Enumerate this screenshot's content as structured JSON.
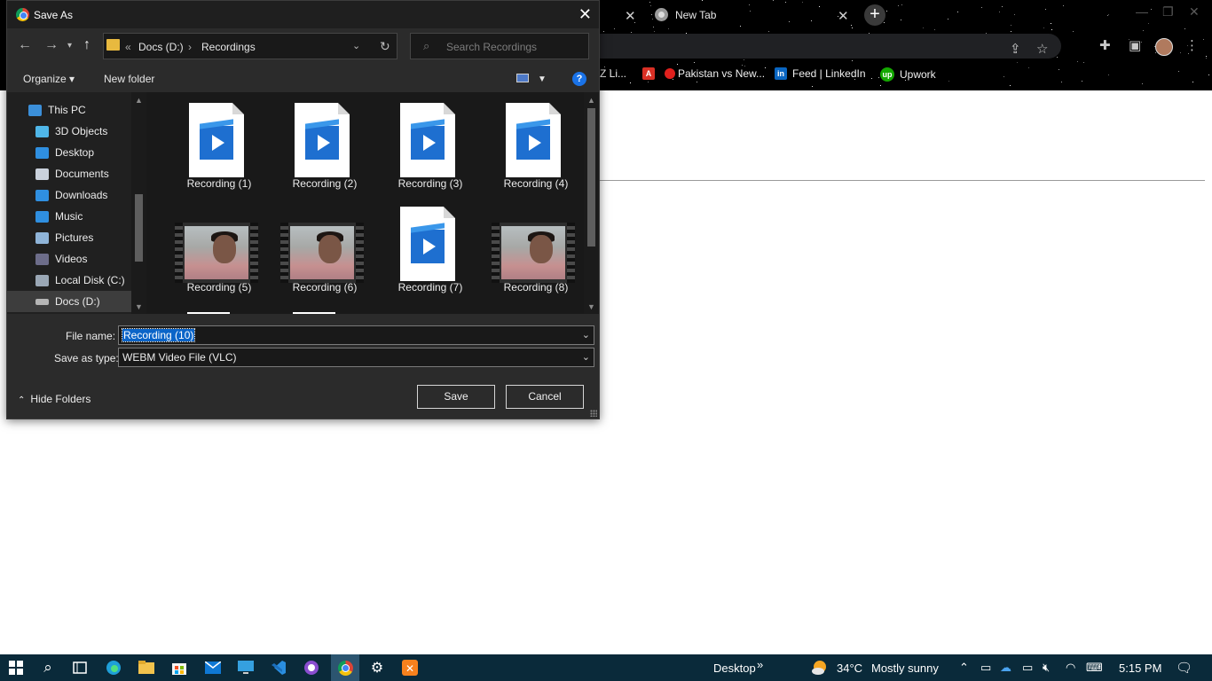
{
  "browser": {
    "tabs": [
      {
        "label": ""
      },
      {
        "label": "New Tab"
      }
    ],
    "new_tab_symbol": "+",
    "bookmarks": [
      {
        "label": "Z Li...",
        "icon": "bookmark-icon",
        "color": "#3a3a3a"
      },
      {
        "label": "",
        "icon": "pdf-icon",
        "color": "#d93025"
      },
      {
        "label": "Pakistan vs New...",
        "icon": "red-dot-icon",
        "color": "#e0201d"
      },
      {
        "label": "Feed | LinkedIn",
        "icon": "linkedin-icon",
        "color": "#0a66c2"
      },
      {
        "label": "Upwork",
        "icon": "upwork-icon",
        "color": "#14a800"
      }
    ]
  },
  "dialog": {
    "title": "Save As",
    "breadcrumb": {
      "prefix": "«",
      "drive": "Docs (D:)",
      "separator": "›",
      "folder": "Recordings"
    },
    "search_placeholder": "Search Recordings",
    "toolbar": {
      "organize": "Organize ▾",
      "new_folder": "New folder",
      "help": "?"
    },
    "nav_items": [
      {
        "label": "This PC",
        "icon": "pc-icon",
        "color": "#3b8fd9"
      },
      {
        "label": "3D Objects",
        "icon": "cube-icon",
        "color": "#4fb6e8"
      },
      {
        "label": "Desktop",
        "icon": "desktop-icon",
        "color": "#2f8fe0"
      },
      {
        "label": "Documents",
        "icon": "documents-icon",
        "color": "#c9d1dc"
      },
      {
        "label": "Downloads",
        "icon": "download-icon",
        "color": "#2f8fe0"
      },
      {
        "label": "Music",
        "icon": "music-icon",
        "color": "#2f8fe0"
      },
      {
        "label": "Pictures",
        "icon": "pictures-icon",
        "color": "#8fb4d8"
      },
      {
        "label": "Videos",
        "icon": "videos-icon",
        "color": "#6d6d8a"
      },
      {
        "label": "Local Disk (C:)",
        "icon": "disk-icon",
        "color": "#9aa7b5"
      },
      {
        "label": "Docs (D:)",
        "icon": "drive-icon",
        "color": "#b5b5b5"
      }
    ],
    "files": [
      {
        "name": "Recording (1)",
        "kind": "doc"
      },
      {
        "name": "Recording (2)",
        "kind": "doc"
      },
      {
        "name": "Recording (3)",
        "kind": "doc"
      },
      {
        "name": "Recording (4)",
        "kind": "doc"
      },
      {
        "name": "Recording (5)",
        "kind": "thumb"
      },
      {
        "name": "Recording (6)",
        "kind": "thumb"
      },
      {
        "name": "Recording (7)",
        "kind": "doc"
      },
      {
        "name": "Recording (8)",
        "kind": "thumb"
      }
    ],
    "file_name_label": "File name:",
    "file_name_value": "Recording (10)",
    "save_type_label": "Save as type:",
    "save_type_value": "WEBM Video File (VLC)",
    "hide_folders": "Hide Folders",
    "save_button": "Save",
    "cancel_button": "Cancel"
  },
  "taskbar": {
    "desktop_label": "Desktop",
    "chevron": "»",
    "temperature": "34°C",
    "weather": "Mostly sunny",
    "time": "5:15 PM"
  }
}
